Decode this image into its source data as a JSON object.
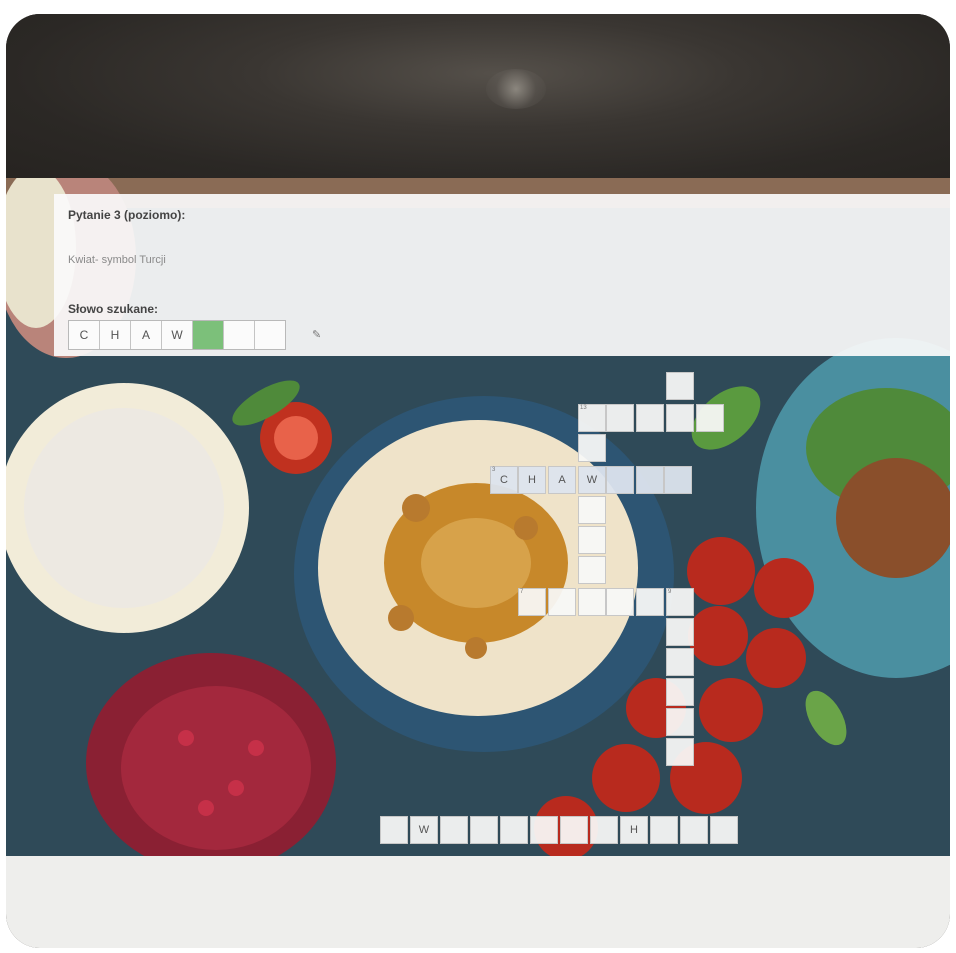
{
  "question": {
    "title": "Pytanie 3 (poziomo):",
    "clue": "Kwiat- symbol Turcji",
    "search_label": "Słowo szukane:",
    "letters": [
      "C",
      "H",
      "A",
      "W",
      "",
      "",
      ""
    ],
    "active_index": 4
  },
  "crossword": {
    "row3_letters": [
      "C",
      "H",
      "A",
      "W"
    ],
    "bottom_letters": [
      "W",
      "H"
    ],
    "numbers": [
      "13",
      "3",
      "7",
      "9"
    ]
  },
  "colors": {
    "active_slot": "#7cc07a",
    "background": "#2f4a58"
  },
  "icons": [
    "edit-icon"
  ]
}
